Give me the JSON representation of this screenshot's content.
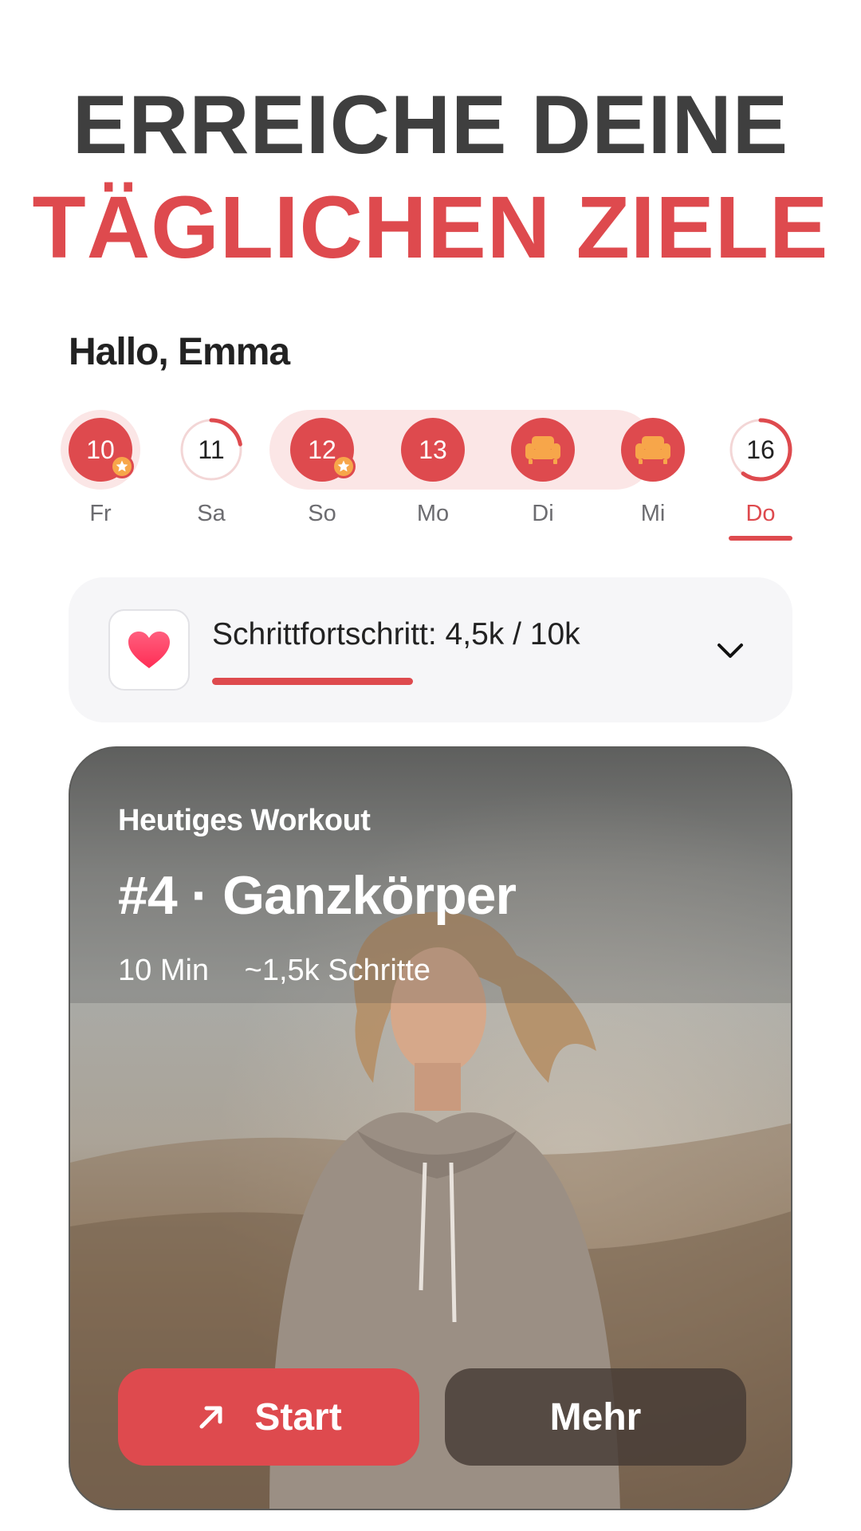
{
  "headline": {
    "line1": "ERREICHE DEINE",
    "line2": "TÄGLICHEN ZIELE"
  },
  "greeting": "Hallo, Emma",
  "days": [
    {
      "num": "10",
      "label": "Fr",
      "state": "completed",
      "star": true,
      "icon": null
    },
    {
      "num": "11",
      "label": "Sa",
      "state": "partial",
      "progress": 0.22,
      "icon": null
    },
    {
      "num": "12",
      "label": "So",
      "state": "completed",
      "star": true,
      "icon": null
    },
    {
      "num": "13",
      "label": "Mo",
      "state": "completed",
      "star": false,
      "icon": null
    },
    {
      "num": "",
      "label": "Di",
      "state": "rest",
      "icon": "armchair-icon"
    },
    {
      "num": "",
      "label": "Mi",
      "state": "rest",
      "icon": "armchair-icon"
    },
    {
      "num": "16",
      "label": "Do",
      "state": "today",
      "progress": 0.6,
      "icon": null
    }
  ],
  "steps": {
    "text": "Schrittfortschritt: 4,5k / 10k",
    "progress": 0.45,
    "icon": "heart-icon"
  },
  "workout": {
    "kicker": "Heutiges Workout",
    "title": "#4 · Ganzkörper",
    "duration": "10 Min",
    "steps": "~1,5k Schritte",
    "start_label": "Start",
    "more_label": "Mehr"
  },
  "colors": {
    "accent": "#de4a4e",
    "accent_light": "#fbe6e6",
    "rest_icon": "#f7a64a",
    "headline_dark": "#3f3f3f"
  }
}
